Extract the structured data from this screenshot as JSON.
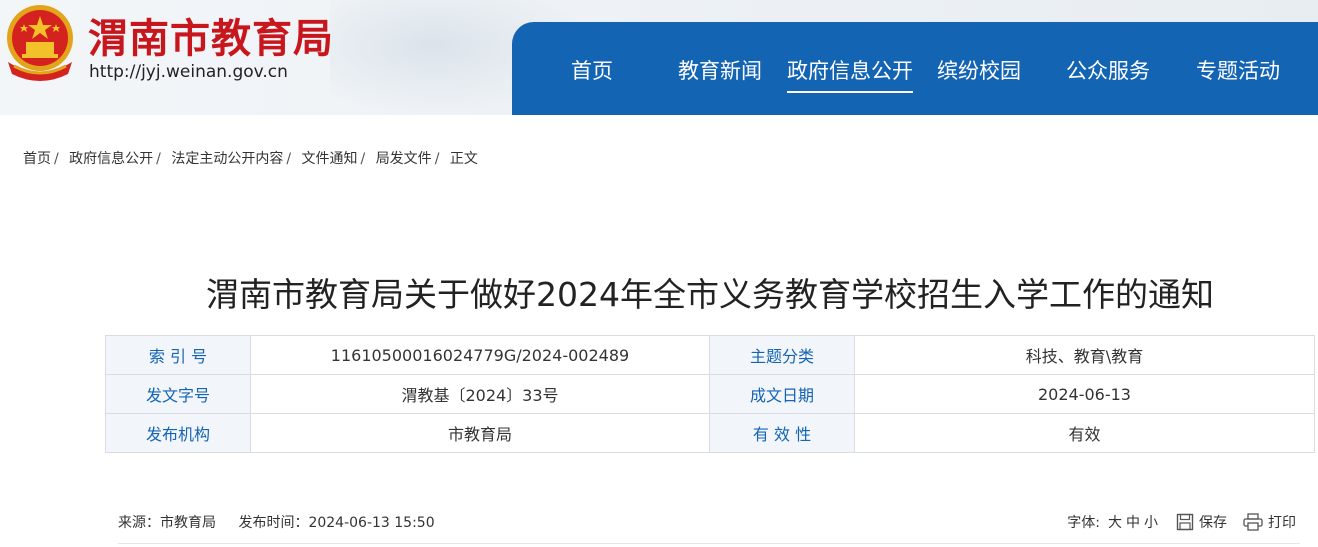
{
  "header": {
    "site_title": "渭南市教育局",
    "site_url": "http://jyj.weinan.gov.cn",
    "brand_color": "#c8161d",
    "nav_color": "#1464b4"
  },
  "nav": {
    "items": [
      {
        "label": "首页"
      },
      {
        "label": "教育新闻"
      },
      {
        "label": "政府信息公开",
        "active": true
      },
      {
        "label": "缤纷校园"
      },
      {
        "label": "公众服务"
      },
      {
        "label": "专题活动"
      }
    ]
  },
  "breadcrumb": {
    "items": [
      "首页",
      "政府信息公开",
      "法定主动公开内容",
      "文件通知",
      "局发文件",
      "正文"
    ],
    "separator": "/"
  },
  "document": {
    "title": "渭南市教育局关于做好2024年全市义务教育学校招生入学工作的通知",
    "meta": {
      "index_label": "索 引 号",
      "index_value": "11610500016024779G/2024-002489",
      "topic_label": "主题分类",
      "topic_value": "科技、教育\\教育",
      "doc_no_label": "发文字号",
      "doc_no_value": "渭教基〔2024〕33号",
      "date_label": "成文日期",
      "date_value": "2024-06-13",
      "publisher_label": "发布机构",
      "publisher_value": "市教育局",
      "validity_label": "有 效 性",
      "validity_value": "有效"
    },
    "source_label": "来源：市教育局",
    "publish_time": "发布时间：2024-06-13 15:50"
  },
  "tools": {
    "font_label": "字体:",
    "font_large": "大",
    "font_medium": "中",
    "font_small": "小",
    "save_label": "保存",
    "print_label": "打印"
  }
}
